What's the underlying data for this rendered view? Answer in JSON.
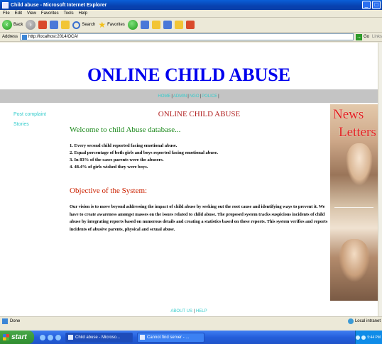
{
  "window": {
    "title": "Child abuse - Microsoft Internet Explorer",
    "controls": [
      "_",
      "□"
    ]
  },
  "menu": [
    "File",
    "Edit",
    "View",
    "Favorites",
    "Tools",
    "Help"
  ],
  "toolbar": {
    "back": "Back",
    "search": "Search",
    "favorites": "Favorites"
  },
  "address": {
    "label": "Address",
    "url": "http://localhost:2014/OCA/",
    "go": "Go",
    "links": "Links"
  },
  "page": {
    "site_title": "ONLINE CHILD ABUSE",
    "nav": [
      "HOME",
      "ADMIN",
      "NGO",
      "POLICE"
    ],
    "sidebar": [
      "Post complaint",
      "Stories"
    ],
    "heading": "ONLINE CHILD ABUSE",
    "welcome": "Welcome to child Abuse database...",
    "facts": [
      "1. Every second child reported facing emotional abuse.",
      "2. Equal percentage of both girls and boys reported facing emotional abuse.",
      "3. In 83% of the cases parents were the abusers.",
      "4. 48.4% of girls wished they were boys."
    ],
    "objective_title": "Objective of the System:",
    "objective_text": "Our vision is to move beyond addressing the impact of child abuse by seeking out the root cause and identifying ways to prevent it. We have to create awareness amongst masses on the issues related to child abuse. The proposed system tracks suspicious incidents of child abuse by integrating reports based on numerous details and creating a statistics based on these reports. This system verifies and reports incidents of abusive parents, physical and sexual abuse.",
    "newsletter": [
      "News",
      "Letters"
    ],
    "footer": [
      "ABOUT US",
      "HELP"
    ]
  },
  "status": {
    "text": "Done",
    "zone": "Local intranet"
  },
  "taskbar": {
    "start": "start",
    "tasks": [
      "Child abuse - Microso...",
      "Cannot find server - ..."
    ],
    "clock": "5:44 PM"
  }
}
